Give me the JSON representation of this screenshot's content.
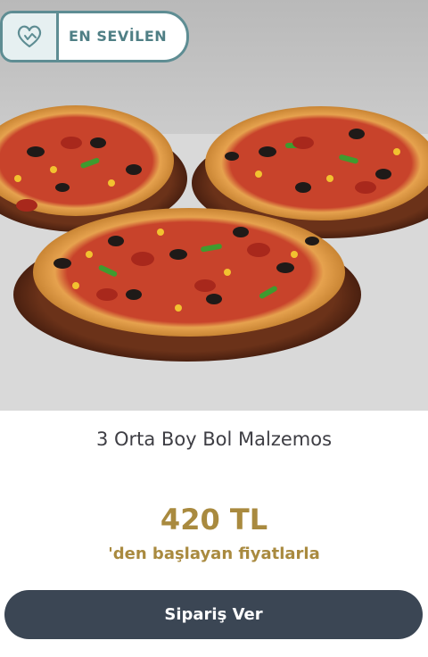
{
  "badge": {
    "label": "EN SEVİLEN",
    "icon": "heart-hand-icon"
  },
  "hero": {
    "image": "three-pizzas-photo"
  },
  "product": {
    "name": "3 Orta Boy Bol Malzemos",
    "price": "420 TL",
    "price_note": "'den başlayan fiyatlarla"
  },
  "actions": {
    "order_label": "Sipariş Ver"
  },
  "colors": {
    "badge_border": "#5e8d93",
    "price": "#a98a3f",
    "button_bg": "#3b4654",
    "title": "#3e3e44"
  }
}
